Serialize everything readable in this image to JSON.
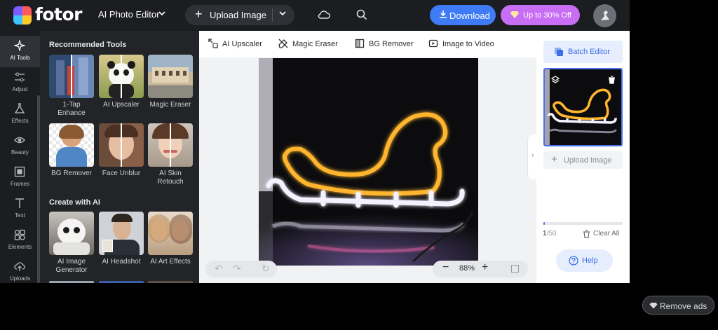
{
  "header": {
    "brand": "fotor",
    "editor_menu": "AI Photo Editor",
    "upload_label": "Upload Image",
    "download_label": "Download",
    "offer_label": "Up to 30% Off"
  },
  "rail": [
    {
      "label": "AI Tools",
      "icon": "sparkle-icon"
    },
    {
      "label": "Adjust",
      "icon": "sliders-icon"
    },
    {
      "label": "Effects",
      "icon": "flask-icon"
    },
    {
      "label": "Beauty",
      "icon": "eye-icon"
    },
    {
      "label": "Frames",
      "icon": "frame-icon"
    },
    {
      "label": "Text",
      "icon": "text-icon"
    },
    {
      "label": "Elements",
      "icon": "shapes-icon"
    },
    {
      "label": "Uploads",
      "icon": "upload-cloud-icon"
    }
  ],
  "tools_panel": {
    "recommended_title": "Recommended Tools",
    "recommended": [
      {
        "label": "1-Tap Enhance"
      },
      {
        "label": "AI Upscaler"
      },
      {
        "label": "Magic Eraser"
      },
      {
        "label": "BG Remover"
      },
      {
        "label": "Face Unblur"
      },
      {
        "label": "AI Skin Retouch"
      }
    ],
    "create_title": "Create with AI",
    "create": [
      {
        "label": "AI Image Generator"
      },
      {
        "label": "AI Headshot"
      },
      {
        "label": "AI Art Effects"
      }
    ]
  },
  "toolbar": {
    "upscaler": "AI Upscaler",
    "eraser": "Magic Eraser",
    "bg_remover": "BG Remover",
    "image_to_video": "Image to Video"
  },
  "canvas": {
    "zoom": "88%",
    "image_subject": "neon sleigh"
  },
  "right_panel": {
    "batch_label": "Batch Editor",
    "upload_label": "Upload Image",
    "count_current": "1",
    "count_max": "/50",
    "progress_fraction": 0.02,
    "clear_label": "Clear All",
    "help_label": "Help"
  },
  "ads": {
    "remove_label": "Remove ads"
  },
  "colors": {
    "accent": "#3e7bf5",
    "offer": "#c76ef4",
    "neon_yellow": "#ffb52e",
    "neon_white": "#f4f1ff"
  }
}
